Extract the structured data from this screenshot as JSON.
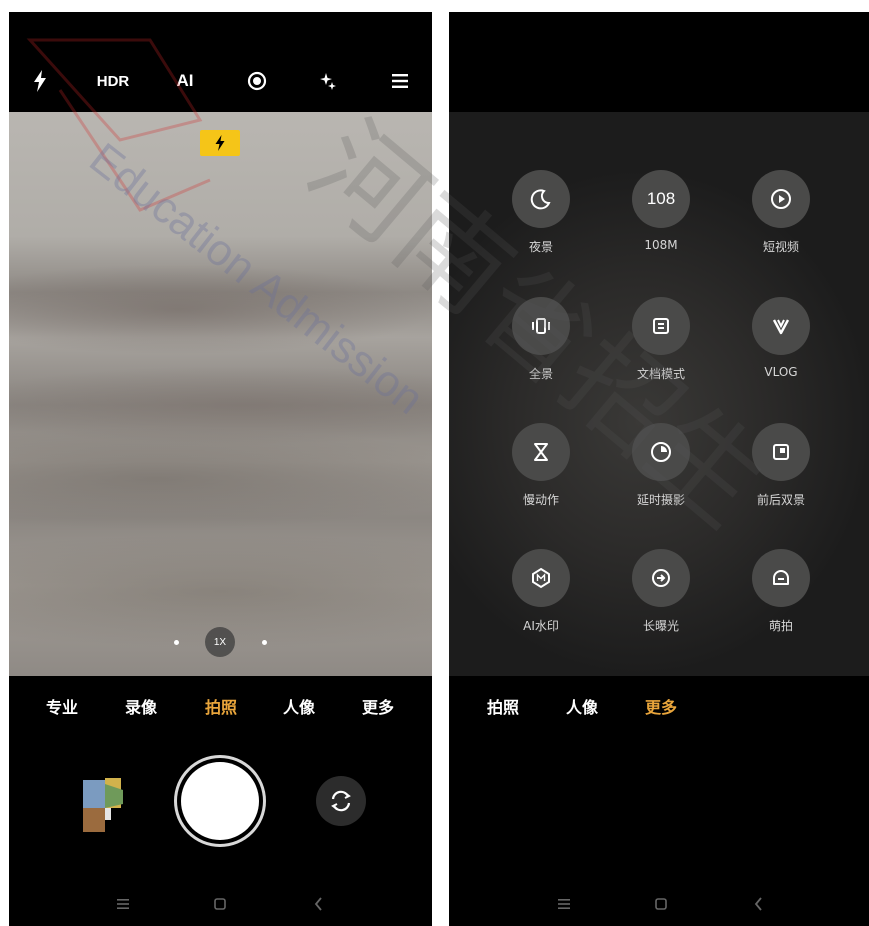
{
  "left_screen": {
    "top_bar": {
      "hdr_label": "HDR",
      "ai_label": "AI"
    },
    "viewfinder": {
      "zoom_label": "1X"
    },
    "mode_bar": [
      "专业",
      "录像",
      "拍照",
      "人像",
      "更多"
    ],
    "active_mode": "拍照"
  },
  "right_screen": {
    "modes": [
      {
        "label": "夜景",
        "icon": "moon-icon"
      },
      {
        "label": "108M",
        "icon": "108-icon",
        "icon_text": "108"
      },
      {
        "label": "短视频",
        "icon": "play-icon"
      },
      {
        "label": "全景",
        "icon": "panorama-icon"
      },
      {
        "label": "文档模式",
        "icon": "document-icon"
      },
      {
        "label": "VLOG",
        "icon": "vlog-icon"
      },
      {
        "label": "慢动作",
        "icon": "hourglass-icon"
      },
      {
        "label": "延时摄影",
        "icon": "timelapse-icon"
      },
      {
        "label": "前后双景",
        "icon": "dual-view-icon"
      },
      {
        "label": "AI水印",
        "icon": "ai-watermark-icon"
      },
      {
        "label": "长曝光",
        "icon": "long-exposure-icon"
      },
      {
        "label": "萌拍",
        "icon": "cute-face-icon"
      }
    ],
    "mode_bar": [
      "拍照",
      "人像",
      "更多"
    ],
    "active_mode": "更多"
  },
  "watermark": {
    "text_cn": "河南省招生",
    "text_en": "Education Admission"
  },
  "colors": {
    "active_mode": "#e9a53b",
    "flash_badge": "#f5c518",
    "mode_circle": "#4a4a49"
  }
}
